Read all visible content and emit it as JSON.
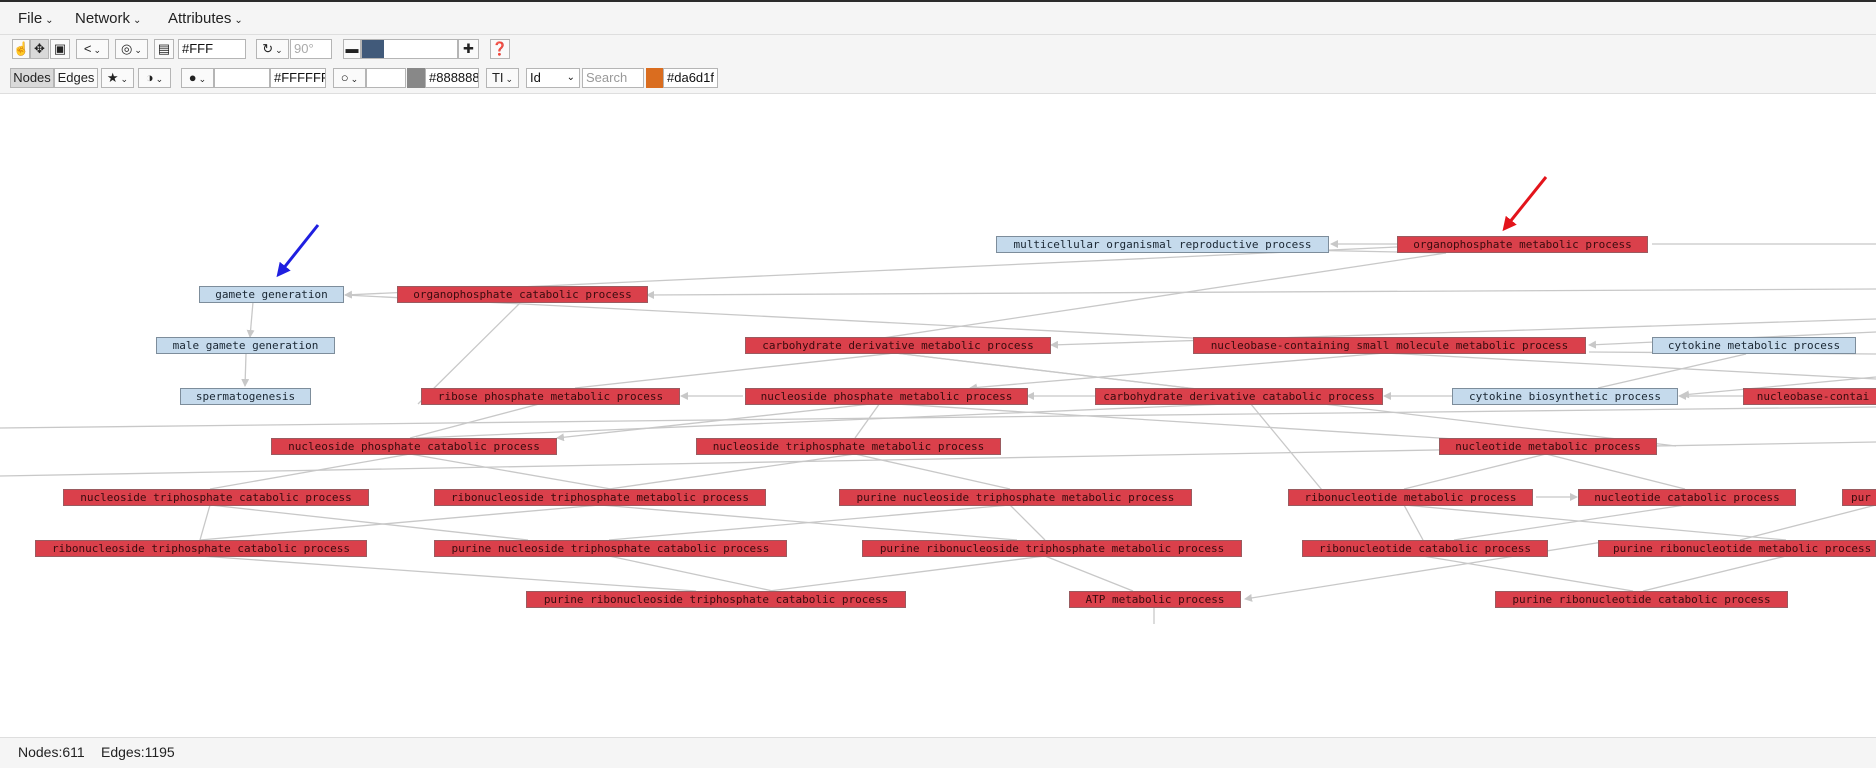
{
  "menus": {
    "file": "File",
    "network": "Network",
    "attributes": "Attributes"
  },
  "toolbar1": {
    "background_color_value": "#FFF",
    "rotation_value": "90°",
    "zoom_bar_color": "#415a7a"
  },
  "toolbar2": {
    "nodes_tab": "Nodes",
    "edges_tab": "Edges",
    "fill_color_value": "#FFFFFF",
    "border_color_value": "#888888",
    "border_swatch": "#888888",
    "label_glyph": "TI",
    "attribute_select": "Id",
    "search_placeholder": "Search",
    "highlight_color_value": "#da6d1f",
    "highlight_swatch": "#da6d1f"
  },
  "graph": {
    "colors": {
      "significant": "#da404b",
      "nonsignificant": "#c5daec",
      "edge": "#c8c8c8"
    },
    "nodes": {
      "multicellular_organismal_reproductive_process": "multicellular organismal reproductive process",
      "organophosphate_metabolic_process": "organophosphate metabolic process",
      "gamete_generation": "gamete generation",
      "organophosphate_catabolic_process": "organophosphate catabolic process",
      "male_gamete_generation": "male gamete generation",
      "carbohydrate_derivative_metabolic_process": "carbohydrate derivative metabolic process",
      "nucleobase_containing_small_molecule_metabolic_process": "nucleobase-containing small molecule metabolic process",
      "cytokine_metabolic_process": "cytokine metabolic process",
      "spermatogenesis": "spermatogenesis",
      "ribose_phosphate_metabolic_process": "ribose phosphate metabolic process",
      "nucleoside_phosphate_metabolic_process": "nucleoside phosphate metabolic process",
      "carbohydrate_derivative_catabolic_process": "carbohydrate derivative catabolic process",
      "cytokine_biosynthetic_process": "cytokine biosynthetic process",
      "nucleobase_containing_partial": "nucleobase-contai",
      "nucleoside_phosphate_catabolic_process": "nucleoside phosphate catabolic process",
      "nucleoside_triphosphate_metabolic_process": "nucleoside triphosphate metabolic process",
      "nucleotide_metabolic_process": "nucleotide metabolic process",
      "nucleoside_triphosphate_catabolic_process": "nucleoside triphosphate catabolic process",
      "ribonucleoside_triphosphate_metabolic_process": "ribonucleoside triphosphate metabolic process",
      "purine_nucleoside_triphosphate_metabolic_process": "purine nucleoside triphosphate metabolic process",
      "ribonucleotide_metabolic_process": "ribonucleotide metabolic process",
      "nucleotide_catabolic_process": "nucleotide catabolic process",
      "purine_partial": "pur",
      "ribonucleoside_triphosphate_catabolic_process": "ribonucleoside triphosphate catabolic process",
      "purine_nucleoside_triphosphate_catabolic_process": "purine nucleoside triphosphate catabolic process",
      "purine_ribonucleoside_triphosphate_metabolic_process": "purine ribonucleoside triphosphate metabolic process",
      "ribonucleotide_catabolic_process": "ribonucleotide catabolic process",
      "purine_ribonucleotide_metabolic_process": "purine ribonucleotide metabolic process",
      "purine_ribonucleoside_triphosphate_catabolic_process": "purine ribonucleoside triphosphate catabolic process",
      "atp_metabolic_process": "ATP metabolic process",
      "purine_ribonucleotide_catabolic_process": "purine ribonucleotide catabolic process"
    },
    "annotation_arrows": {
      "blue": "#1f1fe0",
      "red": "#e3141b"
    }
  },
  "status": {
    "nodes_label": "Nodes:",
    "nodes_count": "611",
    "edges_label": "Edges:",
    "edges_count": "1195"
  }
}
